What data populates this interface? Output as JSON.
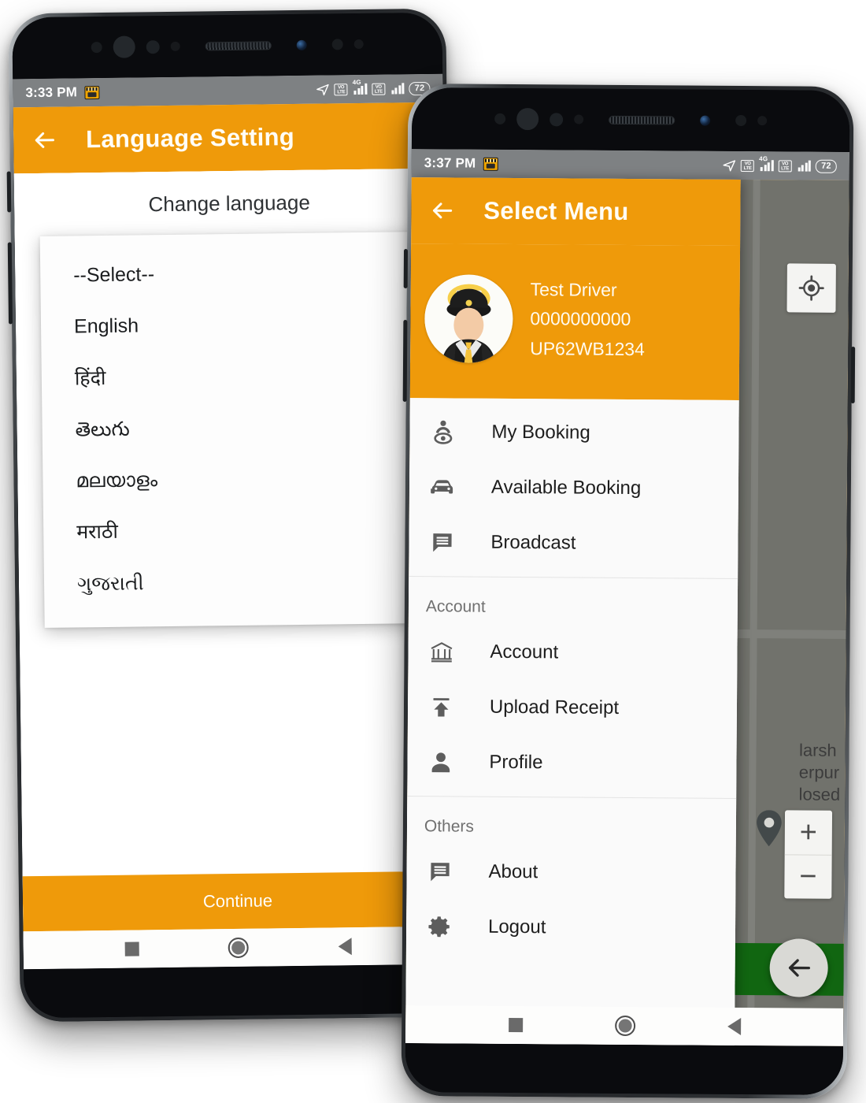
{
  "phone1": {
    "status_bar": {
      "time": "3:33 PM",
      "app_icon": "taxi-app-icon",
      "nav_icon": "location-arrow-icon",
      "volte1": "VoLTE",
      "network": "4G",
      "volte2": "VoLTE",
      "battery": "72"
    },
    "appbar": {
      "back_icon": "back-arrow-icon",
      "title": "Language Setting"
    },
    "section_title": "Change language",
    "dropdown": {
      "options": [
        "--Select--",
        "English",
        "हिंदी",
        "తెలుగు",
        "മലയാളം",
        "मराठी",
        "ગુજરાતી"
      ]
    },
    "continue_label": "Continue",
    "nav": {
      "recents": "square-recents-icon",
      "home": "circle-home-icon",
      "back": "triangle-back-icon"
    }
  },
  "phone2": {
    "status_bar": {
      "time": "3:37 PM",
      "app_icon": "taxi-app-icon",
      "nav_icon": "location-arrow-icon",
      "volte1": "VoLTE",
      "network": "4G",
      "volte2": "VoLTE",
      "battery": "72"
    },
    "appbar": {
      "back_icon": "back-arrow-icon",
      "title": "Select Menu"
    },
    "profile": {
      "avatar": "driver-avatar",
      "name": "Test Driver",
      "phone": "0000000000",
      "vehicle": "UP62WB1234"
    },
    "menu_groups": [
      {
        "label": "",
        "items": [
          {
            "label": "My Booking",
            "icon": "driver-person-icon"
          },
          {
            "label": "Available Booking",
            "icon": "car-icon"
          },
          {
            "label": "Broadcast",
            "icon": "message-icon"
          }
        ]
      },
      {
        "label": "Account",
        "items": [
          {
            "label": "Account",
            "icon": "bank-icon"
          },
          {
            "label": "Upload Receipt",
            "icon": "upload-icon"
          },
          {
            "label": "Profile",
            "icon": "person-icon"
          }
        ]
      },
      {
        "label": "Others",
        "items": [
          {
            "label": "About",
            "icon": "message-icon"
          },
          {
            "label": "Logout",
            "icon": "gear-icon"
          }
        ]
      }
    ],
    "map": {
      "gps_icon": "my-location-icon",
      "label_line1": "larsh",
      "label_line2": "erpur",
      "label_line3": "losed",
      "pin_icon": "map-pin-icon",
      "zoom_in": "+",
      "zoom_out": "−",
      "fab_icon": "back-arrow-icon"
    },
    "nav": {
      "recents": "square-recents-icon",
      "home": "circle-home-icon",
      "back": "triangle-back-icon"
    }
  },
  "colors": {
    "brand_orange": "#ef9a0a",
    "status_grey": "#7e8183",
    "green_bar": "#116611"
  }
}
